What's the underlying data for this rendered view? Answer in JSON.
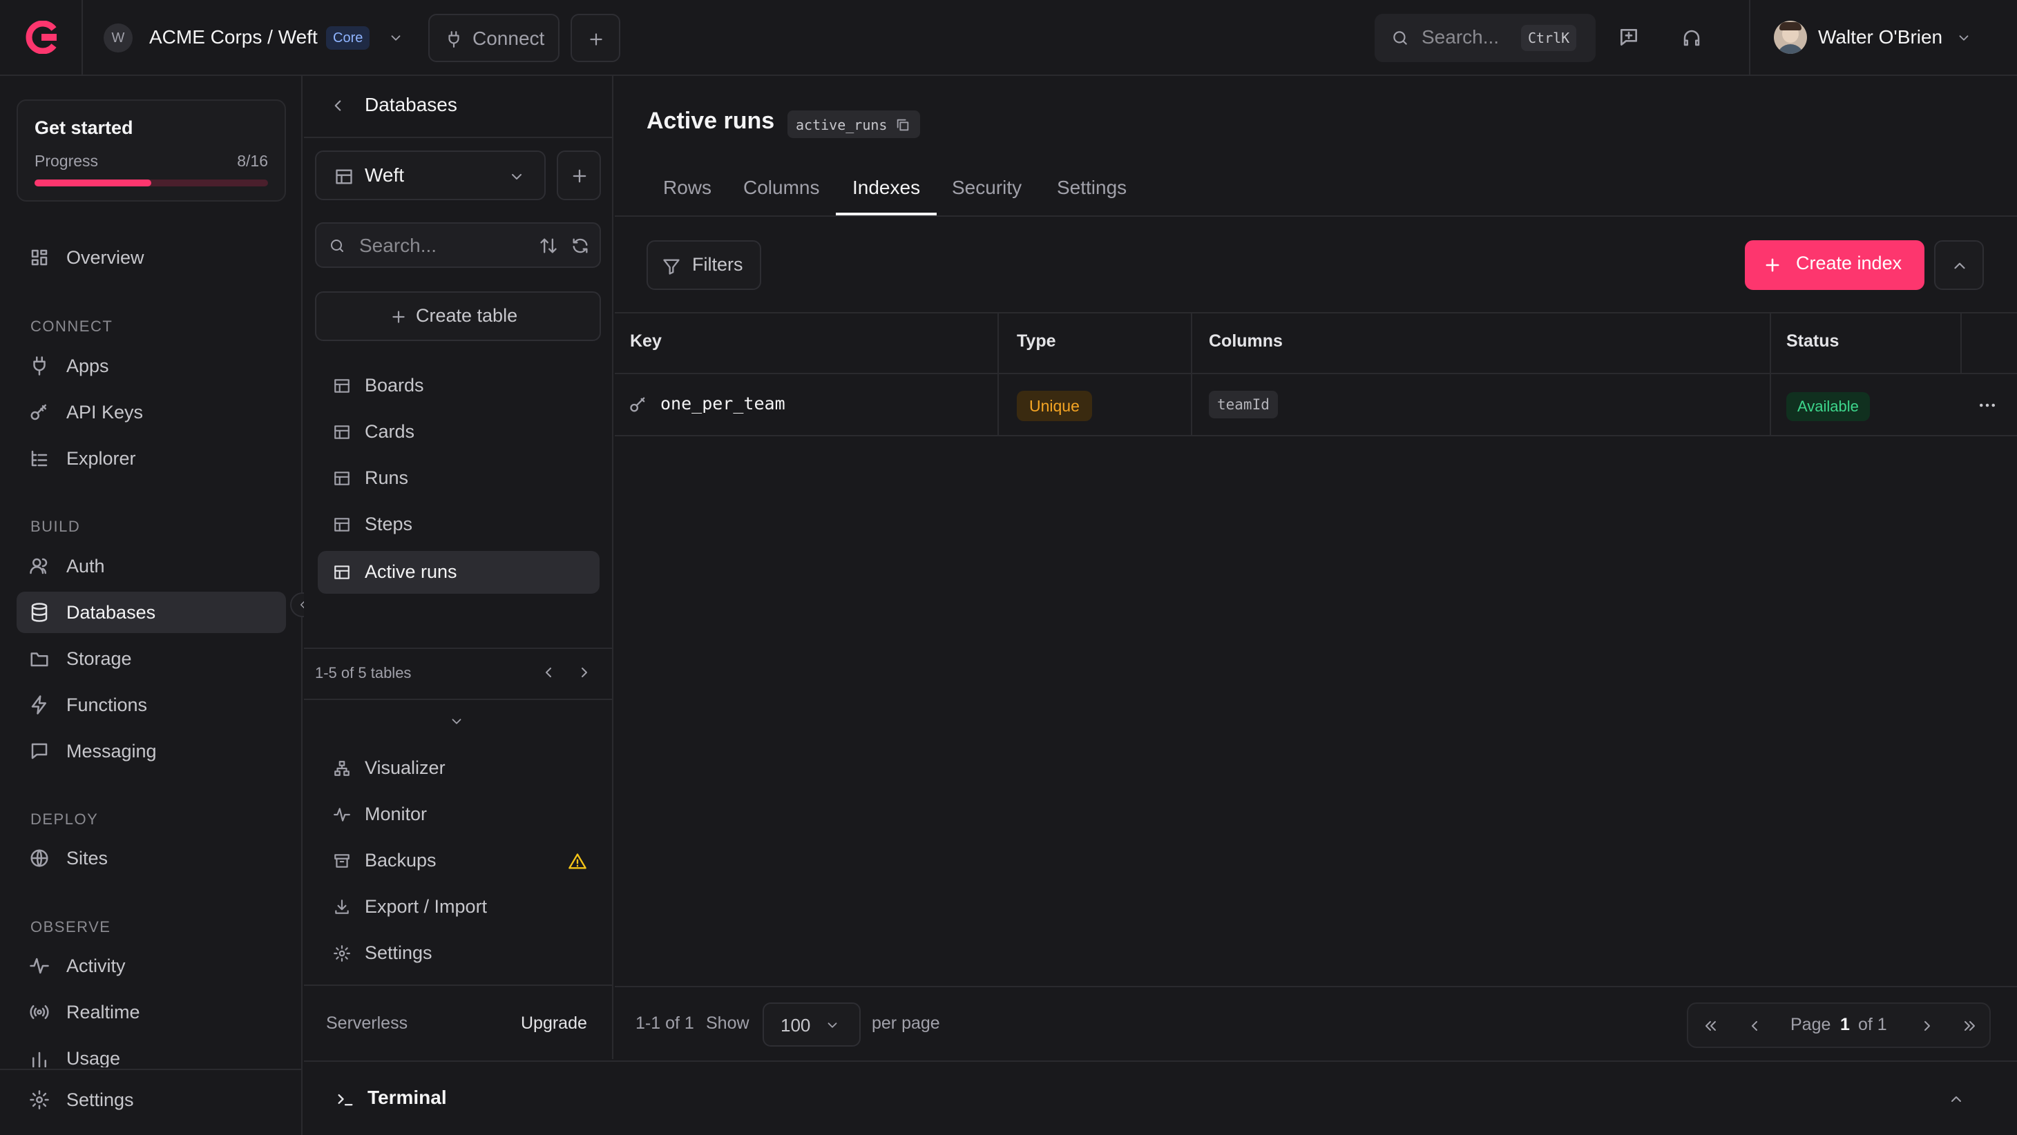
{
  "topbar": {
    "org_initial": "W",
    "project_path": "ACME Corps / Weft",
    "plan_badge": "Core",
    "connect_label": "Connect",
    "search_placeholder": "Search...",
    "search_shortcut": "CtrlK",
    "user_name": "Walter O'Brien"
  },
  "get_started": {
    "title": "Get started",
    "progress_label": "Progress",
    "progress_text": "8/16",
    "progress_value": 0.5
  },
  "sidebar": {
    "overview": "Overview",
    "sections": {
      "connect": "CONNECT",
      "build": "BUILD",
      "deploy": "DEPLOY",
      "observe": "OBSERVE"
    },
    "items": {
      "apps": "Apps",
      "api_keys": "API Keys",
      "explorer": "Explorer",
      "auth": "Auth",
      "databases": "Databases",
      "storage": "Storage",
      "functions": "Functions",
      "messaging": "Messaging",
      "sites": "Sites",
      "activity": "Activity",
      "realtime": "Realtime",
      "usage": "Usage",
      "settings": "Settings"
    }
  },
  "panel": {
    "back_title": "Databases",
    "database_name": "Weft",
    "search_placeholder": "Search...",
    "create_table": "Create table",
    "tables": [
      "Boards",
      "Cards",
      "Runs",
      "Steps",
      "Active runs"
    ],
    "pagination": "1-5 of 5 tables",
    "tools": {
      "visualizer": "Visualizer",
      "monitor": "Monitor",
      "backups": "Backups",
      "export_import": "Export / Import",
      "settings": "Settings"
    },
    "plan": "Serverless",
    "upgrade": "Upgrade"
  },
  "main": {
    "title": "Active runs",
    "table_id": "active_runs",
    "tabs": [
      "Rows",
      "Columns",
      "Indexes",
      "Security",
      "Settings"
    ],
    "active_tab": "Indexes",
    "filters": "Filters",
    "create_index": "Create index",
    "columns": [
      "Key",
      "Type",
      "Columns",
      "Status"
    ],
    "rows": [
      {
        "key": "one_per_team",
        "type": "Unique",
        "columns": "teamId",
        "status": "Available"
      }
    ],
    "footer": {
      "range": "1-1 of 1",
      "show": "Show",
      "per_page_value": "100",
      "per_page": "per page",
      "page_label": "Page",
      "page_current": "1",
      "page_of": "of 1"
    }
  },
  "terminal": {
    "label": "Terminal"
  },
  "colors": {
    "accent": "#fd366e",
    "background": "#19191c",
    "unique_badge_text": "#f5a524",
    "available_text": "#3dd68c"
  }
}
